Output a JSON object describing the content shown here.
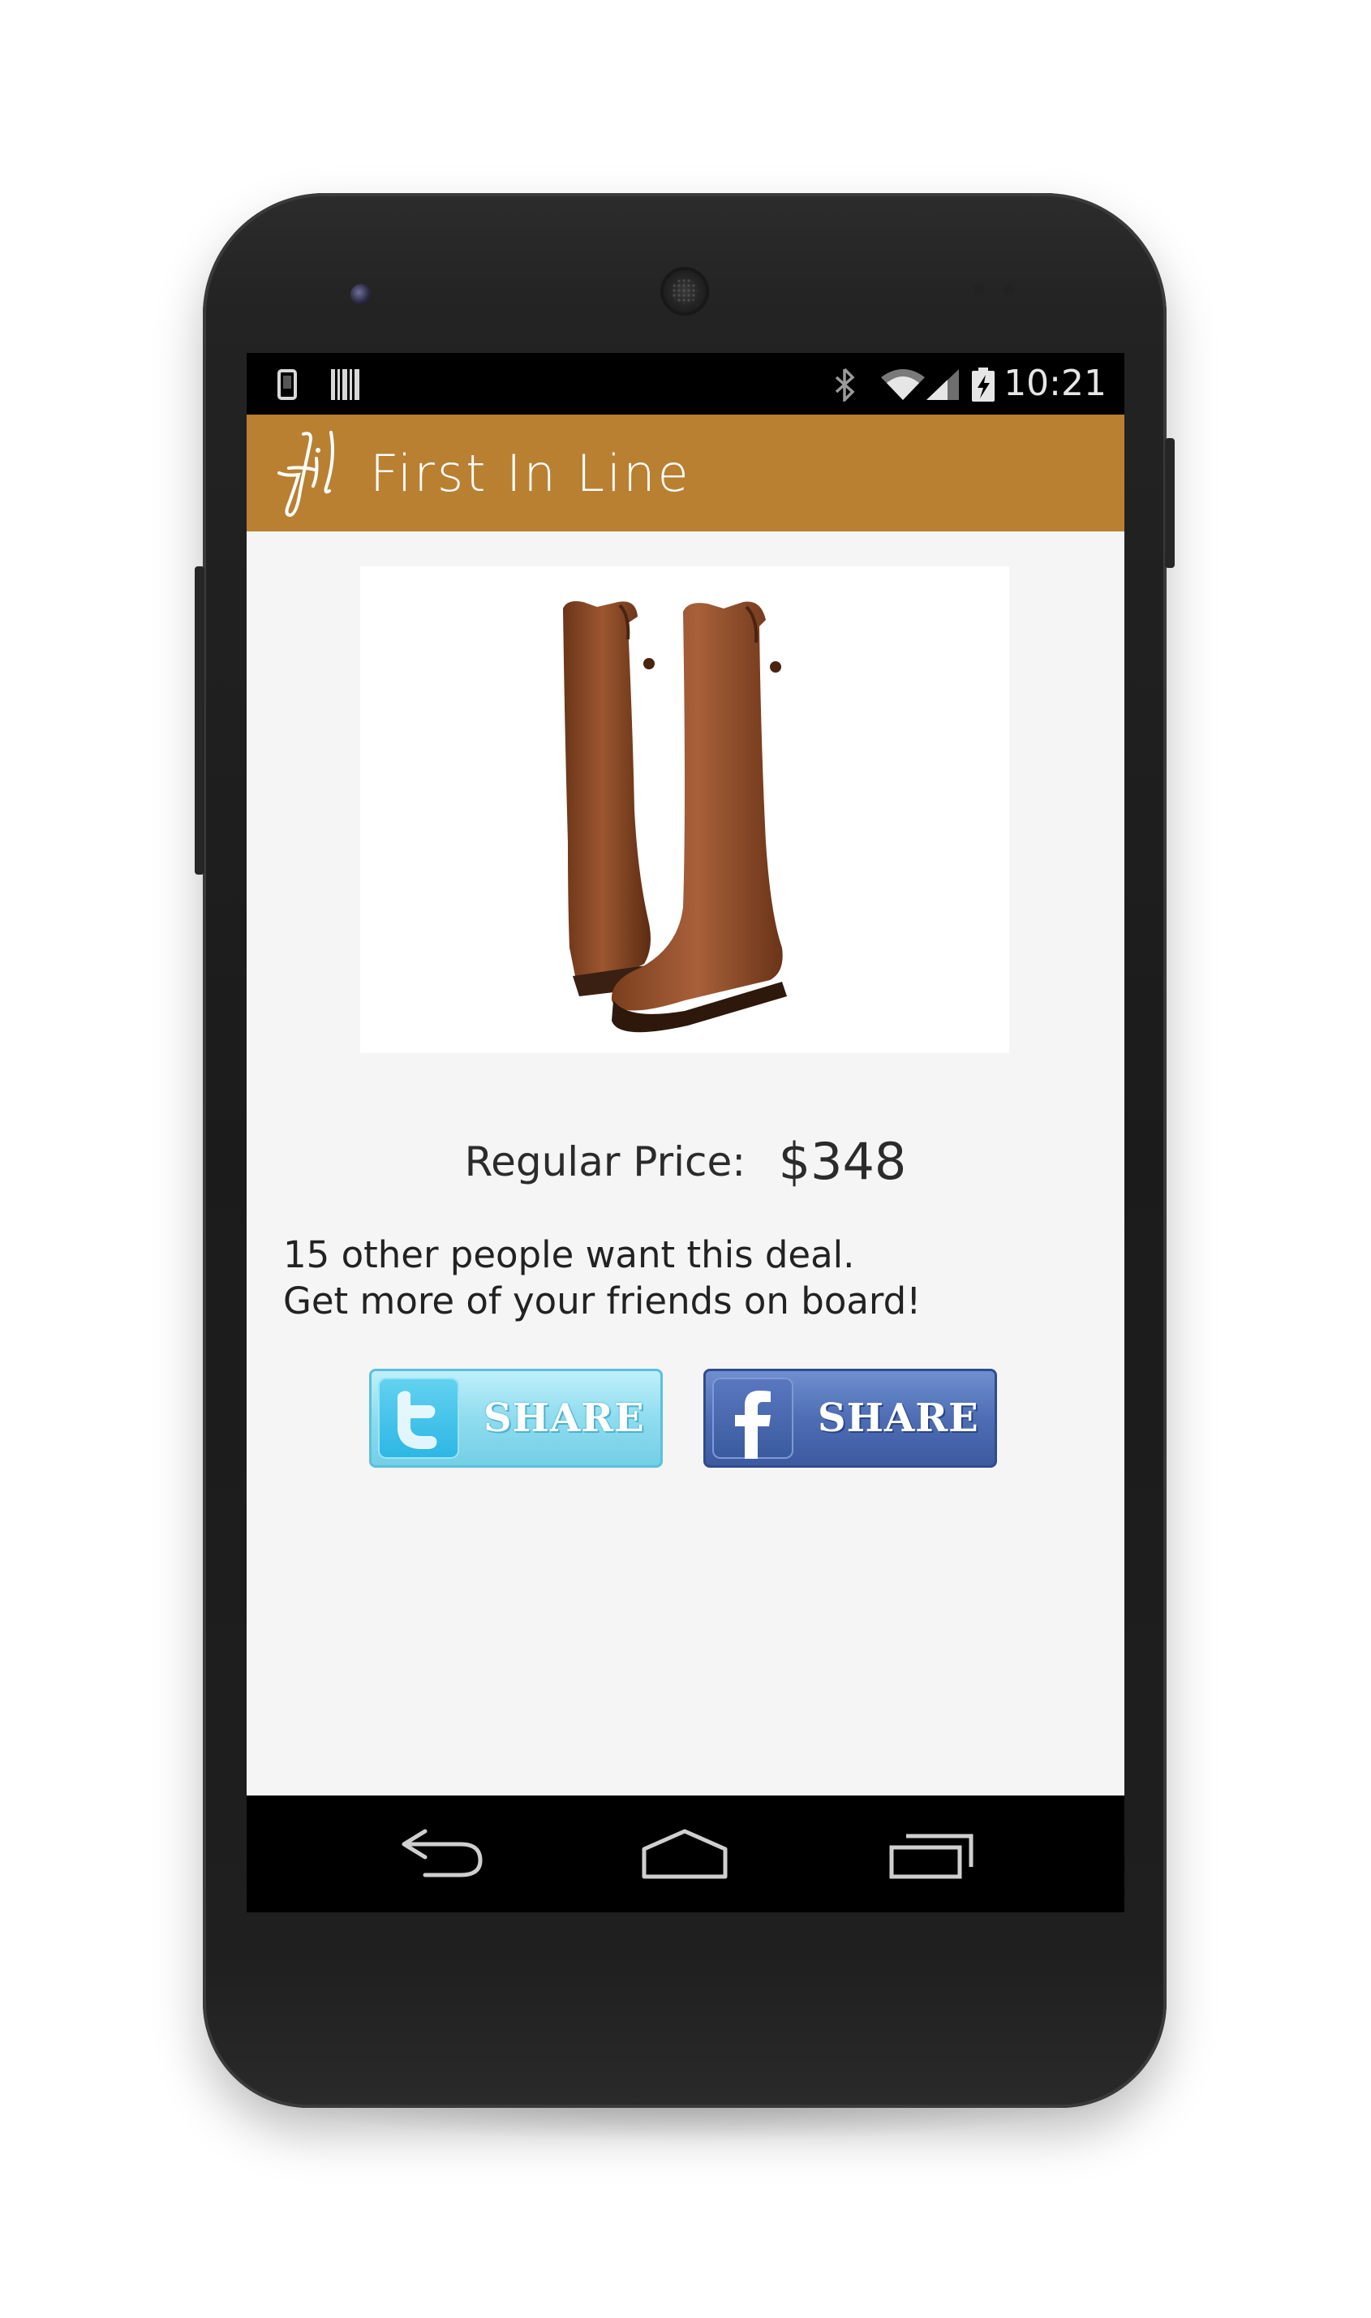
{
  "status_bar": {
    "time": "10:21",
    "left_icons": [
      "phone-icon",
      "barcode-icon"
    ],
    "right_icons": [
      "bluetooth-icon",
      "wifi-icon",
      "signal-icon",
      "battery-charging-icon"
    ]
  },
  "action_bar": {
    "logo_text": "fil",
    "title": "First In Line",
    "color": "#b98032"
  },
  "product": {
    "image": "brown-leather-riding-boots",
    "price_label": "Regular Price:",
    "price": "$348"
  },
  "deal": {
    "line1": "15 other people want this deal.",
    "line2": "Get more of your friends on board!"
  },
  "share": {
    "twitter_label": "SHARE",
    "facebook_label": "SHARE",
    "twitter_icon": "twitter-icon",
    "facebook_icon": "facebook-icon"
  },
  "nav": {
    "icons": [
      "back-icon",
      "home-icon",
      "recents-icon"
    ]
  }
}
